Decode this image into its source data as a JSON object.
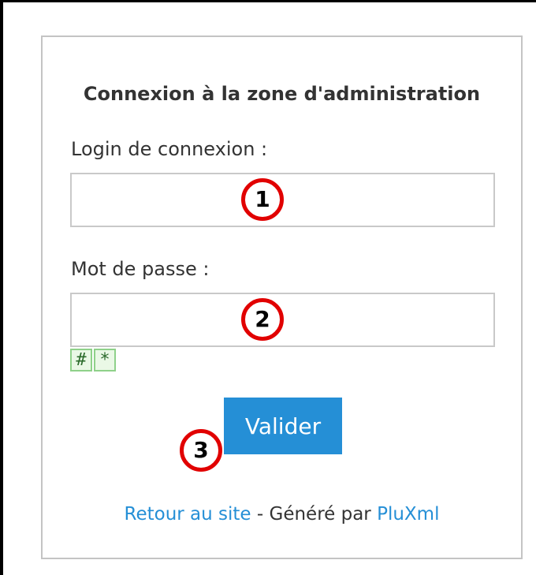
{
  "login": {
    "title": "Connexion à la zone d'administration",
    "login_label": "Login de connexion :",
    "login_value": "",
    "password_label": "Mot de passe :",
    "password_value": "",
    "toggle_hash": "#",
    "toggle_star": "*",
    "submit_label": "Valider"
  },
  "footer": {
    "back_link": "Retour au site",
    "separator": " - Généré par ",
    "brand_link": "PluXml"
  },
  "annotations": {
    "marker_1": "1",
    "marker_2": "2",
    "marker_3": "3"
  },
  "colors": {
    "accent": "#258fd6",
    "marker_ring": "#e10000",
    "toggle_border": "#8fd18a"
  }
}
